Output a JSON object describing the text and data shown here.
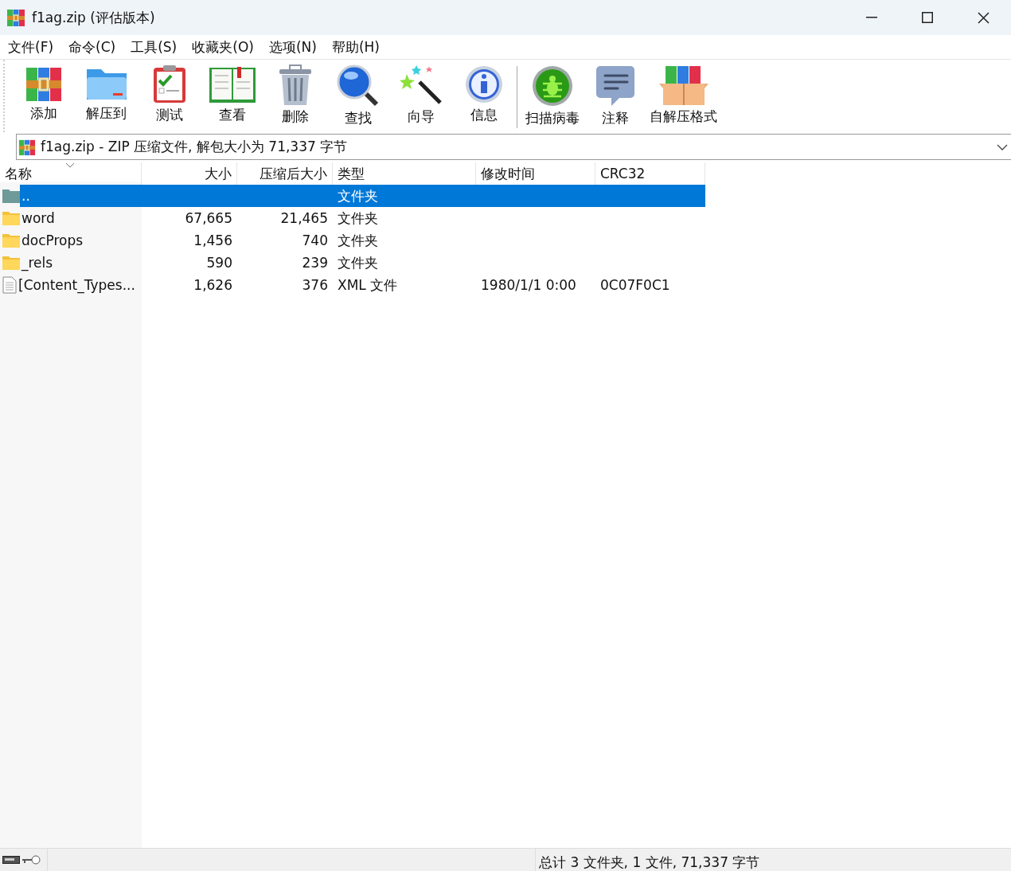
{
  "window": {
    "title": "f1ag.zip (评估版本)"
  },
  "menu": [
    "文件(F)",
    "命令(C)",
    "工具(S)",
    "收藏夹(O)",
    "选项(N)",
    "帮助(H)"
  ],
  "toolbar": [
    {
      "label": "添加"
    },
    {
      "label": "解压到"
    },
    {
      "label": "测试"
    },
    {
      "label": "查看"
    },
    {
      "label": "删除"
    },
    {
      "label": "查找"
    },
    {
      "label": "向导"
    },
    {
      "label": "信息"
    },
    {
      "label": "扫描病毒"
    },
    {
      "label": "注释"
    },
    {
      "label": "自解压格式"
    }
  ],
  "address": "f1ag.zip - ZIP 压缩文件, 解包大小为 71,337 字节",
  "table": {
    "columns": [
      "名称",
      "大小",
      "压缩后大小",
      "类型",
      "修改时间",
      "CRC32"
    ],
    "rows": [
      {
        "kind": "parent",
        "name": "..",
        "size": "",
        "packed": "",
        "type": "文件夹",
        "modified": "",
        "crc": "",
        "selected": true
      },
      {
        "kind": "folder",
        "name": "word",
        "size": "67,665",
        "packed": "21,465",
        "type": "文件夹",
        "modified": "",
        "crc": "",
        "selected": false
      },
      {
        "kind": "folder",
        "name": "docProps",
        "size": "1,456",
        "packed": "740",
        "type": "文件夹",
        "modified": "",
        "crc": "",
        "selected": false
      },
      {
        "kind": "folder",
        "name": "_rels",
        "size": "590",
        "packed": "239",
        "type": "文件夹",
        "modified": "",
        "crc": "",
        "selected": false
      },
      {
        "kind": "file",
        "name": "[Content_Types...",
        "size": "1,626",
        "packed": "376",
        "type": "XML 文件",
        "modified": "1980/1/1 0:00",
        "crc": "0C07F0C1",
        "selected": false
      }
    ]
  },
  "status_bar": "总计 3 文件夹, 1 文件, 71,337 字节"
}
